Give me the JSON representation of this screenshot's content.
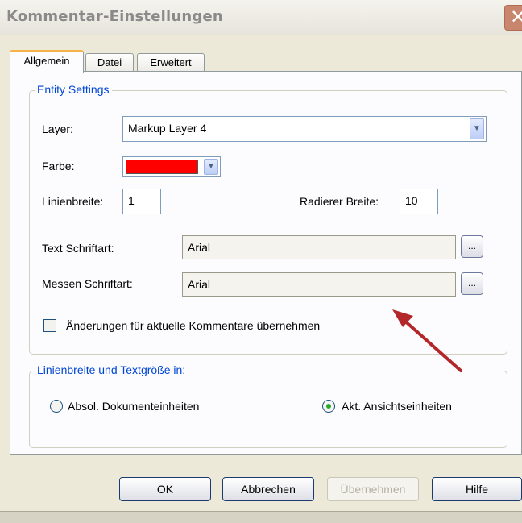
{
  "window": {
    "title": "Kommentar-Einstellungen",
    "close_symbol": "✕"
  },
  "tabs": [
    {
      "label": "Allgemein",
      "active": true
    },
    {
      "label": "Datei",
      "active": false
    },
    {
      "label": "Erweitert",
      "active": false
    }
  ],
  "entity_settings": {
    "legend": "Entity Settings",
    "layer_label": "Layer:",
    "layer_value": "Markup Layer 4",
    "color_label": "Farbe:",
    "color_value": "#ff0000",
    "line_width_label": "Linienbreite:",
    "line_width_value": "1",
    "eraser_width_label": "Radierer Breite:",
    "eraser_width_value": "10",
    "text_font_label": "Text Schriftart:",
    "text_font_value": "Arial",
    "measure_font_label": "Messen Schriftart:",
    "measure_font_value": "Arial",
    "browse_label": "...",
    "apply_checkbox_label": "Änderungen für aktuelle Kommentare übernehmen",
    "apply_checkbox_checked": false
  },
  "units_group": {
    "legend": "Linienbreite und Textgröße in:",
    "option_absolute": "Absol. Dokumenteinheiten",
    "option_view": "Akt. Ansichtseinheiten",
    "selected": "view"
  },
  "buttons": {
    "ok": "OK",
    "cancel": "Abbrechen",
    "apply": "Übernehmen",
    "help": "Hilfe"
  },
  "annotation": {
    "arrow_color": "#b3262a"
  }
}
